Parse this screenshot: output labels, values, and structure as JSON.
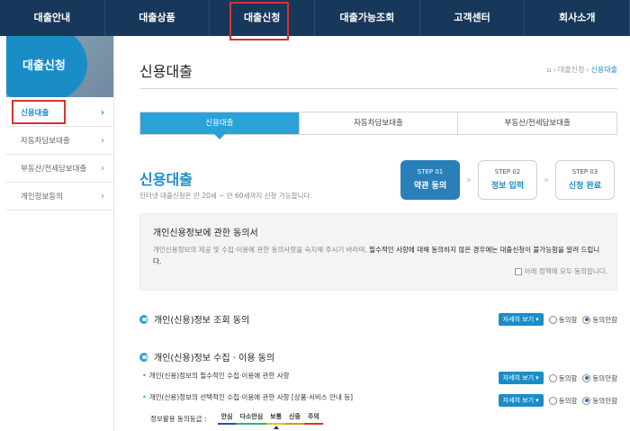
{
  "top_nav": {
    "items": [
      "대출안내",
      "대출상품",
      "대출신청",
      "대출가능조회",
      "고객센터",
      "회사소개"
    ],
    "active_index": 2
  },
  "sidebar": {
    "banner_title": "대출신청",
    "items": [
      {
        "label": "신용대출",
        "active": true
      },
      {
        "label": "자동차담보대출",
        "active": false
      },
      {
        "label": "부동산/전세담보대출",
        "active": false
      },
      {
        "label": "개인정보동의",
        "active": false
      }
    ]
  },
  "page": {
    "title": "신용대출",
    "breadcrumb": [
      "대출신청",
      "신용대출"
    ]
  },
  "tabs": [
    {
      "label": "신용대출",
      "active": true
    },
    {
      "label": "자동차담보대출",
      "active": false
    },
    {
      "label": "부동산/전세담보대출",
      "active": false
    }
  ],
  "section": {
    "title": "신용대출",
    "desc": "인터넷 대출신청은 만 20세 ~ 만 60세까지 신청 가능합니다."
  },
  "steps": [
    {
      "no": "STEP 01",
      "name": "약관 동의",
      "active": true
    },
    {
      "no": "STEP 02",
      "name": "정보 입력",
      "active": false
    },
    {
      "no": "STEP 03",
      "name": "신청 완료",
      "active": false
    }
  ],
  "consent_box": {
    "title": "개인신용정보에 관한 동의서",
    "text_part1": "개인신용정보의 제공 및 수집·이용에 관한 동의사항을 숙지해 주시기 바라며, ",
    "text_bold": "필수적인 사항에 대해 동의하지 않은 경우에는 대출신청이 불가능함을 알려 드립니다.",
    "agree_all_label": "아래 정책에 모두 동의합니다.",
    "agree_all_checked": false
  },
  "consents": {
    "inquiry_title": "개인(신용)정보 조회 동의",
    "collect_title": "개인(신용)정보 수집 · 이용 동의",
    "collect_required": "개인(신용)정보의 필수적인 수집·이용에 관한 사항",
    "collect_optional": "개인(신용)정보의 선택적인 수집·이용에 관한 사항 [상품·서비스 안내 등]",
    "detail_label": "자세히 보기",
    "agree_label": "동의함",
    "disagree_label": "동의안함",
    "selected": "disagree"
  },
  "grade": {
    "label": "정보활용 동의등급 :",
    "levels": [
      "안심",
      "다소안심",
      "보통",
      "신중",
      "주의"
    ],
    "marker_index": 2
  }
}
